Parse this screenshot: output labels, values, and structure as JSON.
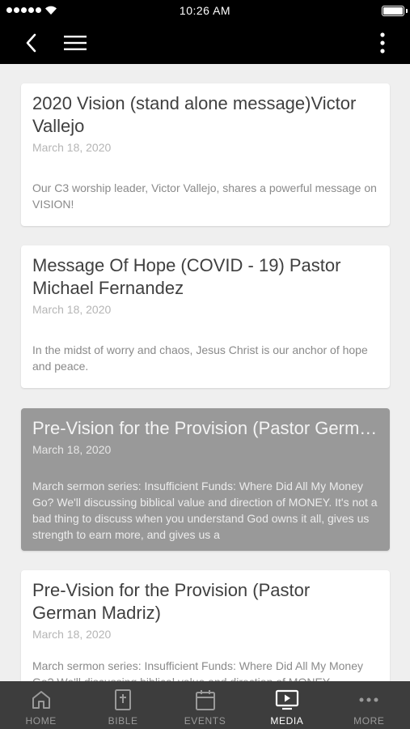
{
  "status_bar": {
    "time": "10:26 AM"
  },
  "nav": {
    "back_icon": "chevron-left-icon",
    "menu_icon": "hamburger-menu-icon",
    "more_icon": "vertical-dots-icon"
  },
  "cards": [
    {
      "title": "2020 Vision (stand alone message)Victor Vallejo",
      "date": "March 18, 2020",
      "description": "Our C3 worship leader, Victor Vallejo, shares a powerful message on VISION!"
    },
    {
      "title": "Message Of Hope (COVID - 19) Pastor Michael Fernandez",
      "date": "March 18, 2020",
      "description": "In the midst of worry and chaos, Jesus Christ is our anchor of hope and peace."
    },
    {
      "title": "Pre-Vision for the Provision (Pastor German Madriz)",
      "date": "March 18, 2020",
      "description": "March sermon series: Insufficient Funds: Where Did All My Money Go? We'll discussing biblical value and direction of MONEY. It's not a bad thing to discuss when you understand God owns it all, gives us strength to earn more, and gives us a"
    },
    {
      "title": "Pre-Vision for the Provision (Pastor German Madriz)",
      "date": "March 18, 2020",
      "description": "March sermon series: Insufficient Funds: Where Did All My Money Go? We'll discussing biblical value and direction of MONEY."
    }
  ],
  "tabs": [
    {
      "label": "HOME",
      "icon": "home-icon"
    },
    {
      "label": "BIBLE",
      "icon": "bible-icon"
    },
    {
      "label": "EVENTS",
      "icon": "calendar-icon"
    },
    {
      "label": "MEDIA",
      "icon": "media-icon"
    },
    {
      "label": "MORE",
      "icon": "more-dots-icon"
    }
  ],
  "colors": {
    "bar_background": "#000000",
    "tab_bar_background": "#3d3d3d",
    "page_background": "#efefef",
    "selected_card": "#999999"
  }
}
